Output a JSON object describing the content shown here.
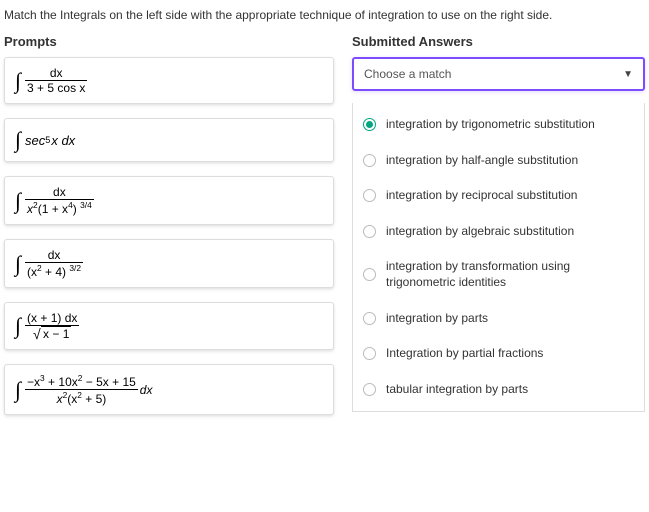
{
  "instructions": "Match the Integrals on the left side with the appropriate technique of integration to use on the right side.",
  "headers": {
    "prompts": "Prompts",
    "submitted": "Submitted Answers"
  },
  "match": {
    "placeholder": "Choose a match",
    "arrow": "▼"
  },
  "prompts": [
    {
      "numerator": "dx",
      "denominator": "3 + 5 cos x",
      "style": "frac"
    },
    {
      "expr_pre": "sec",
      "sup": "5",
      "expr_post": "x dx",
      "style": "inline"
    },
    {
      "numerator": "dx",
      "denom_pre": "x",
      "denom_sup1": "2",
      "denom_mid": "(1 + x",
      "denom_sup2": "4",
      "denom_post": ") ",
      "denom_outer_sup": "3/4",
      "style": "frac2"
    },
    {
      "numerator": "dx",
      "denom_pre": "(x",
      "denom_sup1": "2",
      "denom_mid": " + 4) ",
      "denom_outer_sup": "3/2",
      "style": "frac3"
    },
    {
      "numerator": "(x + 1) dx",
      "sqrt": "x − 1",
      "style": "frac_sqrt"
    },
    {
      "num_pre": "−x",
      "num_sup1": "3",
      "num_mid": " + 10x",
      "num_sup2": "2",
      "num_post": " − 5x + 15",
      "denom_pre": "x",
      "denom_sup1": "2",
      "denom_mid": "(x",
      "denom_sup2": "2",
      "denom_post": " + 5)",
      "trail": "dx",
      "style": "frac_poly"
    }
  ],
  "options": [
    {
      "label": "integration by trigonometric substitution",
      "selected": true
    },
    {
      "label": "integration by half-angle substitution",
      "selected": false
    },
    {
      "label": "integration by reciprocal substitution",
      "selected": false
    },
    {
      "label": "integration by algebraic substitution",
      "selected": false
    },
    {
      "label": "integration by transformation using trigonometric identities",
      "selected": false
    },
    {
      "label": "integration by parts",
      "selected": false
    },
    {
      "label": "Integration by partial fractions",
      "selected": false
    },
    {
      "label": "tabular integration by parts",
      "selected": false
    }
  ],
  "glyph": {
    "integral": "∫"
  }
}
